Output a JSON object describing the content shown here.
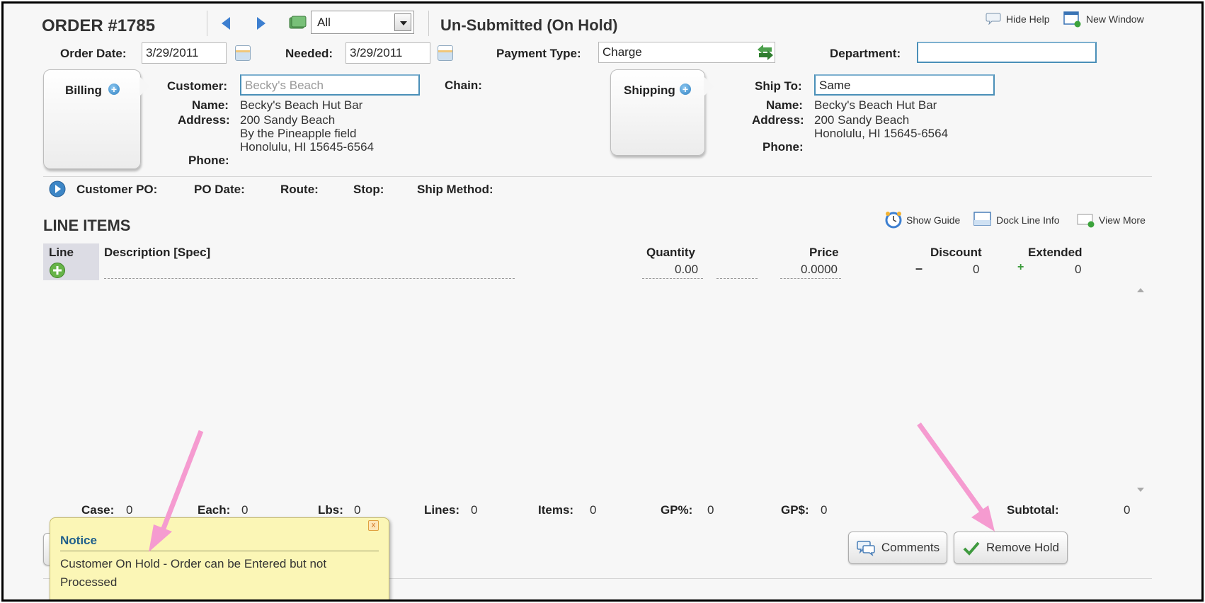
{
  "header": {
    "order_title": "ORDER #1785",
    "filter_value": "All",
    "status": "Un-Submitted (On Hold)",
    "hide_help": "Hide Help",
    "new_window": "New Window"
  },
  "fields": {
    "order_date_label": "Order Date:",
    "order_date": "3/29/2011",
    "needed_label": "Needed:",
    "needed": "3/29/2011",
    "payment_type_label": "Payment Type:",
    "payment_type": "Charge",
    "department_label": "Department:",
    "department": ""
  },
  "billing": {
    "tab_label": "Billing",
    "customer_label": "Customer:",
    "customer_placeholder": "Becky's Beach",
    "name_label": "Name:",
    "name": "Becky's Beach Hut Bar",
    "address_label": "Address:",
    "address_line1": "200 Sandy Beach",
    "address_line2": "By the Pineapple field",
    "address_line3": "Honolulu, HI 15645-6564",
    "phone_label": "Phone:",
    "chain_label": "Chain:"
  },
  "shipping": {
    "tab_label": "Shipping",
    "ship_to_label": "Ship To:",
    "ship_to": "Same",
    "name_label": "Name:",
    "name": "Becky's Beach Hut Bar",
    "address_label": "Address:",
    "address_line1": "200 Sandy Beach",
    "address_line2": "Honolulu, HI 15645-6564",
    "phone_label": "Phone:"
  },
  "po_bar": {
    "customer_po": "Customer PO:",
    "po_date": "PO Date:",
    "route": "Route:",
    "stop": "Stop:",
    "ship_method": "Ship Method:"
  },
  "line_items": {
    "title": "LINE ITEMS",
    "show_guide": "Show Guide",
    "dock_line_info": "Dock Line Info",
    "view_more": "View More",
    "columns": {
      "line": "Line",
      "description": "Description [Spec]",
      "quantity": "Quantity",
      "price": "Price",
      "discount": "Discount",
      "extended": "Extended"
    },
    "row": {
      "quantity": "0.00",
      "price": "0.0000",
      "discount_sign": "–",
      "discount": "0",
      "extended_sign": "+",
      "extended": "0"
    }
  },
  "totals": {
    "case_label": "Case:",
    "case": "0",
    "each_label": "Each:",
    "each": "0",
    "lbs_label": "Lbs:",
    "lbs": "0",
    "lines_label": "Lines:",
    "lines": "0",
    "items_label": "Items:",
    "items": "0",
    "gp_pct_label": "GP%:",
    "gp_pct": "0",
    "gp_dollar_label": "GP$:",
    "gp_dollar": "0",
    "subtotal_label": "Subtotal:",
    "subtotal": "0"
  },
  "buttons": {
    "comments": "Comments",
    "remove_hold": "Remove Hold"
  },
  "notice": {
    "title": "Notice",
    "message": "Customer On Hold - Order can be Entered but not Processed",
    "close": "x"
  },
  "colors": {
    "annotation_arrow": "#f59bd0",
    "notice_bg": "#fbf6b6",
    "notice_title": "#1f5f8b",
    "focus_border": "#4a8fb8",
    "nav_arrow": "#3d7fd0"
  }
}
